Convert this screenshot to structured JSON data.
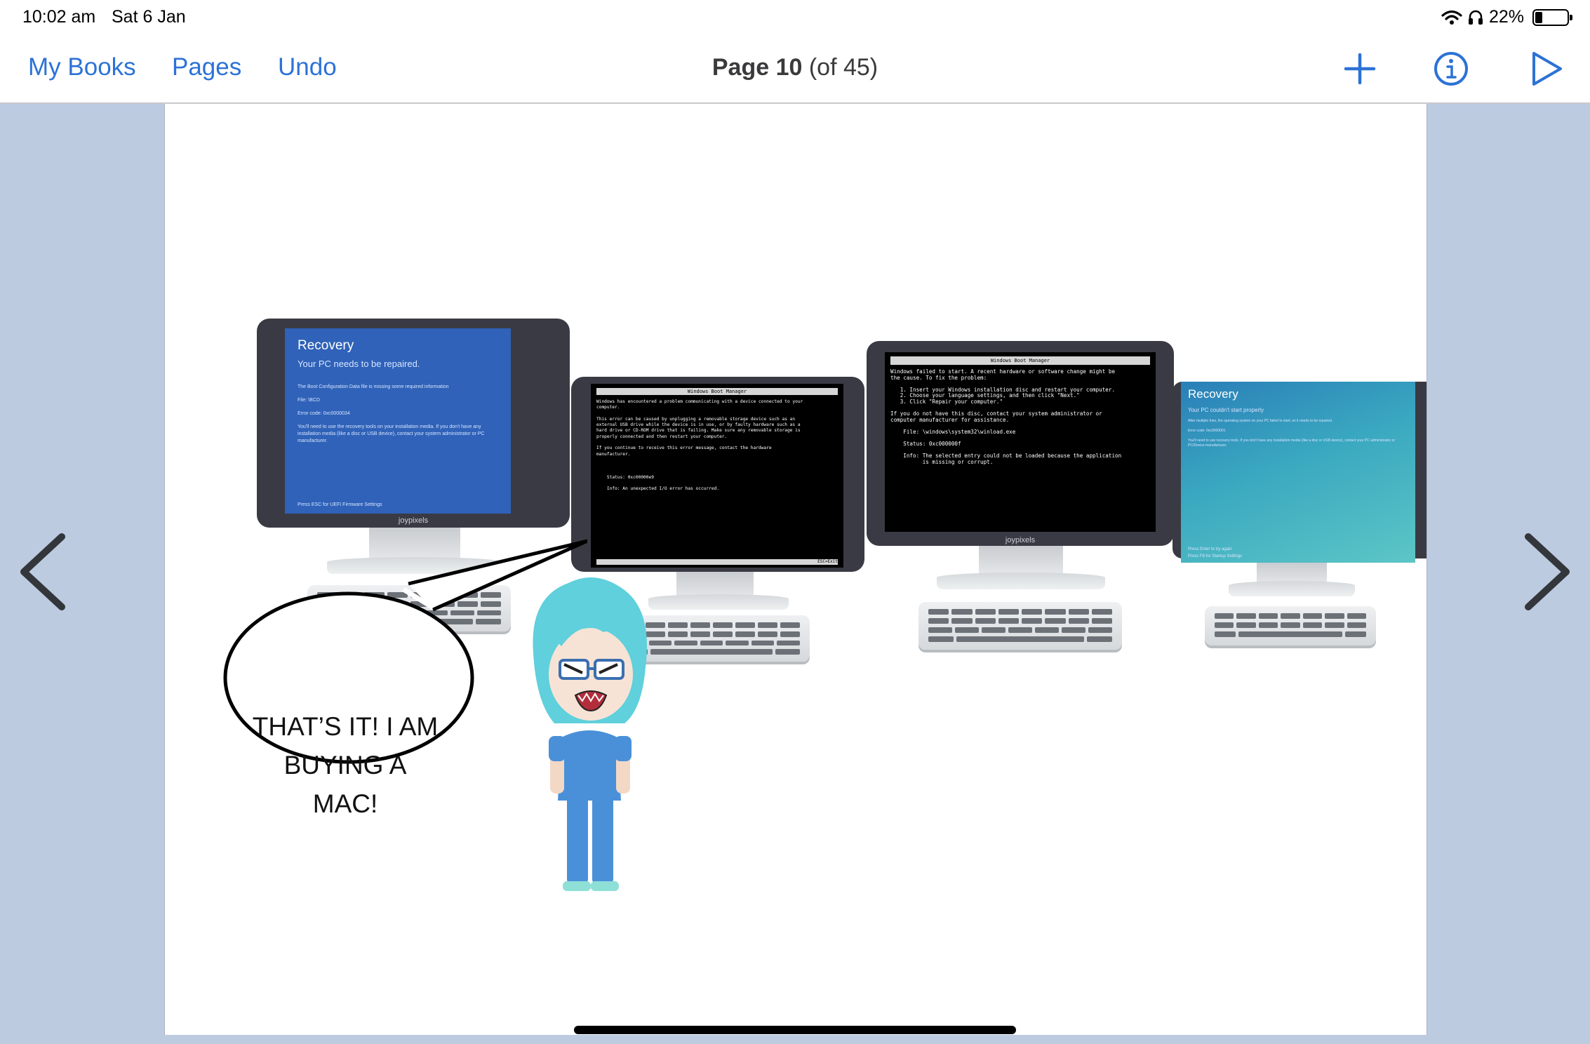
{
  "status_bar": {
    "time": "10:02 am",
    "date": "Sat 6 Jan",
    "battery_percent": "22%",
    "battery_level": 0.22
  },
  "nav": {
    "my_books": "My Books",
    "pages": "Pages",
    "undo": "Undo",
    "page_label": "Page 10",
    "page_of": "(of 45)",
    "icons": [
      "plus-icon",
      "info-icon",
      "play-icon"
    ],
    "accent_color": "#2c72d6"
  },
  "monitors": [
    {
      "type": "recovery-blue",
      "title": "Recovery",
      "subtitle": "Your PC needs to be repaired.",
      "lines": [
        "The Boot Configuration Data file is missing some required information",
        "File: \\BCD",
        "Error code: 0xc0000034",
        "You'll need to use the recovery tools on your installation media. If you don't have any installation media (like a disc or USB device), contact your system administrator or PC manufacturer."
      ],
      "footer": "Press ESC for UEFI Firmware Settings",
      "brand": "joypixels"
    },
    {
      "type": "boot-manager",
      "header": "Windows Boot Manager",
      "lines": [
        "Windows has encountered a problem communicating with a device connected to your",
        "computer.",
        "",
        "This error can be caused by unplugging a removable storage device such as an",
        "external USB drive while the device is in use, or by faulty hardware such as a",
        "hard drive or CD-ROM drive that is failing. Make sure any removable storage is",
        "properly connected and then restart your computer.",
        "",
        "If you continue to receive this error message, contact the hardware",
        "manufacturer.",
        "",
        "",
        "",
        "    Status: 0xc00000e9",
        "",
        "    Info: An unexpected I/O error has occurred."
      ],
      "footer": "ESC=Exit"
    },
    {
      "type": "boot-manager",
      "header": "Windows Boot Manager",
      "lines": [
        "Windows failed to start. A recent hardware or software change might be",
        "the cause. To fix the problem:",
        "",
        "   1. Insert your Windows installation disc and restart your computer.",
        "   2. Choose your language settings, and then click \"Next.\"",
        "   3. Click \"Repair your computer.\"",
        "",
        "If you do not have this disc, contact your system administrator or",
        "computer manufacturer for assistance.",
        "",
        "    File: \\windows\\system32\\winload.exe",
        "",
        "    Status: 0xc000000f",
        "",
        "    Info: The selected entry could not be loaded because the application",
        "          is missing or corrupt."
      ],
      "brand": "joypixels"
    },
    {
      "type": "recovery-teal",
      "title": "Recovery",
      "subtitle": "Your PC couldn't start properly",
      "lines": [
        "After multiple tries, the operating system on your PC failed to start, so it needs to be repaired.",
        "Error code: 0xc0000001",
        "You'll need to use recovery tools. If you don't have any installation media (like a disc or USB device), contact your PC administrator or PC/Device manufacturer."
      ],
      "footer_lines": [
        "Press Enter to try again",
        "Press F8 for Startup Settings"
      ]
    }
  ],
  "speech_bubble": {
    "line1": "THAT’S IT! I AM",
    "line2": "BUYING A",
    "line3": "MAC!"
  },
  "navigation_arrows": [
    "chevron-left-icon",
    "chevron-right-icon"
  ]
}
